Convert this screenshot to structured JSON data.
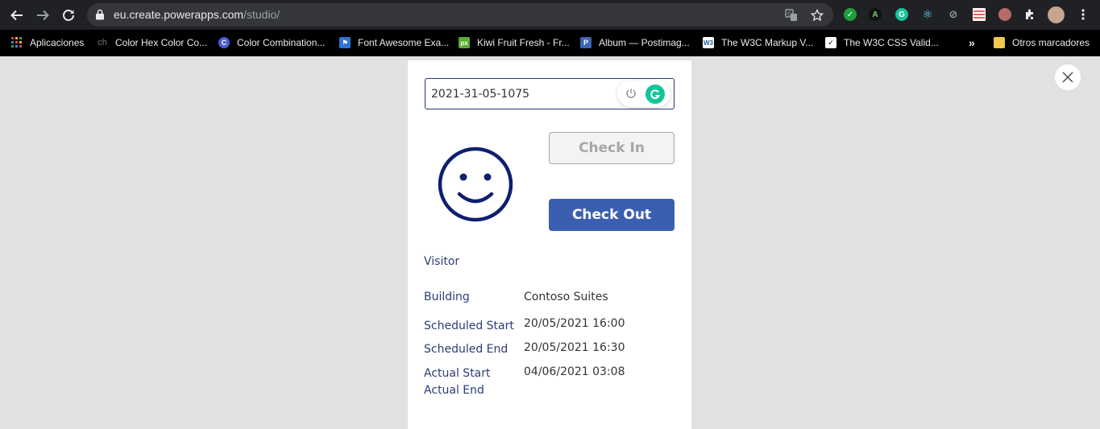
{
  "browser": {
    "url_host": "eu.create.powerapps.com",
    "url_path": "/studio/",
    "icons": {
      "back": "arrow-left-icon",
      "forward": "arrow-right-icon",
      "reload": "reload-icon",
      "lock": "lock-icon",
      "translate": "translate-icon",
      "bookmark": "star-icon",
      "extensions": "puzzle-icon",
      "menu": "kebab-menu-icon"
    }
  },
  "bookmarks": {
    "items": [
      {
        "label": "Aplicaciones",
        "icon": "apps-grid-icon",
        "color": "#e94235"
      },
      {
        "label": "Color Hex Color Co...",
        "icon": "colorhex-icon",
        "color": "#444444"
      },
      {
        "label": "Color Combination...",
        "icon": "c-circle-icon",
        "color": "#4a5bd6"
      },
      {
        "label": "Font Awesome Exa...",
        "icon": "flag-icon",
        "color": "#2d74d8"
      },
      {
        "label": "Kiwi Fruit Fresh - Fr...",
        "icon": "px-icon",
        "color": "#5aad2e"
      },
      {
        "label": "Album — Postimag...",
        "icon": "p-icon",
        "color": "#3e64b7"
      },
      {
        "label": "The W3C Markup V...",
        "icon": "w3c-icon",
        "color": "#ffffff"
      },
      {
        "label": "The W3C CSS Valid...",
        "icon": "w3c-css-icon",
        "color": "#ffffff"
      }
    ],
    "more": "»",
    "other_folder": "Otros marcadores"
  },
  "app": {
    "id_input": {
      "value": "2021-31-05-1075"
    },
    "check_in_label": "Check In",
    "check_out_label": "Check Out",
    "visitor_label": "Visitor",
    "fields": [
      {
        "label": "Building",
        "value": "Contoso Suites"
      },
      {
        "label": "Scheduled Start",
        "value": "20/05/2021 16:00"
      },
      {
        "label": "Scheduled End",
        "value": "20/05/2021 16:30"
      },
      {
        "label": "Actual Start",
        "value": "04/06/2021 03:08"
      },
      {
        "label": "Actual End",
        "value": ""
      }
    ],
    "colors": {
      "accent": "#3b5fb0",
      "label": "#2b3e74",
      "smiley": "#0f1f6e",
      "grammarly": "#15c39a"
    }
  }
}
